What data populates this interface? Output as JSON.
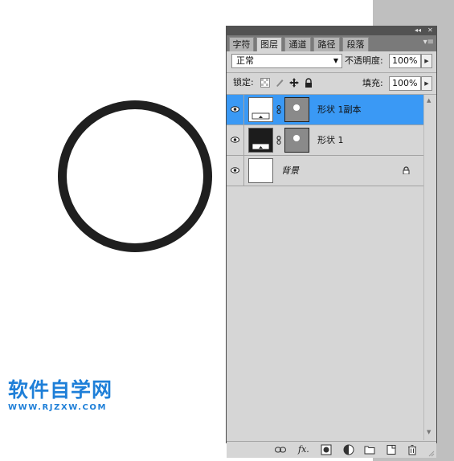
{
  "watermark": {
    "title": "软件自学网",
    "url": "WWW.RJZXW.COM"
  },
  "panel": {
    "topbar": {
      "collapse": "◂◂",
      "close": "✕"
    },
    "tabs": [
      {
        "label": "字符",
        "active": false
      },
      {
        "label": "图层",
        "active": true
      },
      {
        "label": "通道",
        "active": false
      },
      {
        "label": "路径",
        "active": false
      },
      {
        "label": "段落",
        "active": false
      }
    ],
    "menu_glyph": "▾≡",
    "blend_mode": "正常",
    "opacity_label": "不透明度:",
    "opacity_value": "100%",
    "lock_label": "锁定:",
    "fill_label": "填充:",
    "fill_value": "100%",
    "layers": [
      {
        "name": "形状 1副本",
        "selected": true,
        "thumb": "white-shape",
        "has_mask": true
      },
      {
        "name": "形状 1",
        "selected": false,
        "thumb": "black-shape",
        "has_mask": true
      },
      {
        "name": "背景",
        "selected": false,
        "thumb": "white",
        "has_mask": false,
        "locked": true
      }
    ],
    "bottom_icons": [
      "link-layers-icon",
      "fx-icon",
      "add-mask-icon",
      "adjustment-layer-icon",
      "new-group-icon",
      "new-layer-icon",
      "trash-icon"
    ],
    "fx_label": "fx."
  },
  "colors": {
    "selection": "#3a99f5",
    "circle_stroke": "#1f1f1f",
    "watermark": "#1e7fd8"
  }
}
